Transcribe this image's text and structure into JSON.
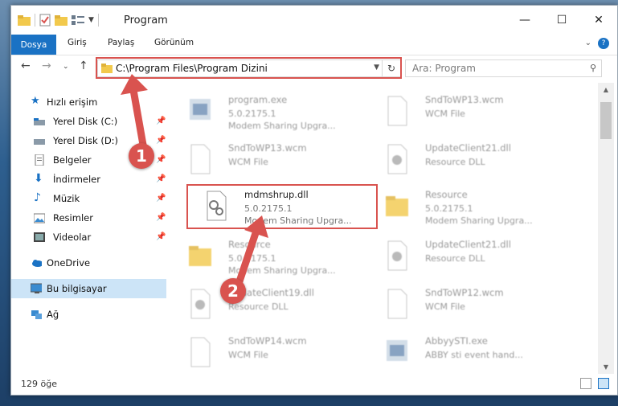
{
  "window": {
    "title": "Program"
  },
  "ribbon": {
    "tabs": [
      "Dosya",
      "Giriş",
      "Paylaş",
      "Görünüm"
    ]
  },
  "address": {
    "path": "C:\\Program Files\\Program Dizini"
  },
  "search": {
    "placeholder": "Ara: Program"
  },
  "sidebar": {
    "items": [
      {
        "label": "Hızlı erişim",
        "icon": "star-icon"
      },
      {
        "label": "Yerel Disk (C:)",
        "icon": "drive-icon"
      },
      {
        "label": "Yerel Disk (D:)",
        "icon": "drive-icon"
      },
      {
        "label": "Belgeler",
        "icon": "documents-icon"
      },
      {
        "label": "İndirmeler",
        "icon": "download-icon"
      },
      {
        "label": "Müzik",
        "icon": "music-icon"
      },
      {
        "label": "Resimler",
        "icon": "pictures-icon"
      },
      {
        "label": "Videolar",
        "icon": "video-icon"
      },
      {
        "label": "OneDrive",
        "icon": "cloud-icon"
      },
      {
        "label": "Bu bilgisayar",
        "icon": "computer-icon"
      },
      {
        "label": "Ağ",
        "icon": "network-icon"
      }
    ]
  },
  "files": [
    {
      "name": "program.exe",
      "version": "5.0.2175.1",
      "desc": "Modem Sharing Upgra..."
    },
    {
      "name": "SndToWP13.wcm",
      "version": "WCM File",
      "desc": ""
    },
    {
      "name": "SndToWP13.wcm",
      "version": "WCM File",
      "desc": ""
    },
    {
      "name": "UpdateClient21.dll",
      "version": "Resource DLL",
      "desc": ""
    },
    {
      "name": "mdmshrup.dll",
      "version": "5.0.2175.1",
      "desc": "Modem Sharing Upgra..."
    },
    {
      "name": "Resource",
      "version": "5.0.2175.1",
      "desc": "Modem Sharing Upgra..."
    },
    {
      "name": "Resource",
      "version": "5.0.2175.1",
      "desc": "Modem Sharing Upgra..."
    },
    {
      "name": "UpdateClient21.dll",
      "version": "Resource DLL",
      "desc": ""
    },
    {
      "name": "UpdateClient19.dll",
      "version": "Resource DLL",
      "desc": ""
    },
    {
      "name": "SndToWP12.wcm",
      "version": "WCM File",
      "desc": ""
    },
    {
      "name": "SndToWP14.wcm",
      "version": "WCM File",
      "desc": ""
    },
    {
      "name": "AbbyySTI.exe",
      "version": "ABBY sti event hand...",
      "desc": ""
    }
  ],
  "status": {
    "count": "129 öğe"
  },
  "callouts": [
    "1",
    "2"
  ],
  "colors": {
    "accent": "#1a72c4",
    "highlight": "#d9534f"
  }
}
